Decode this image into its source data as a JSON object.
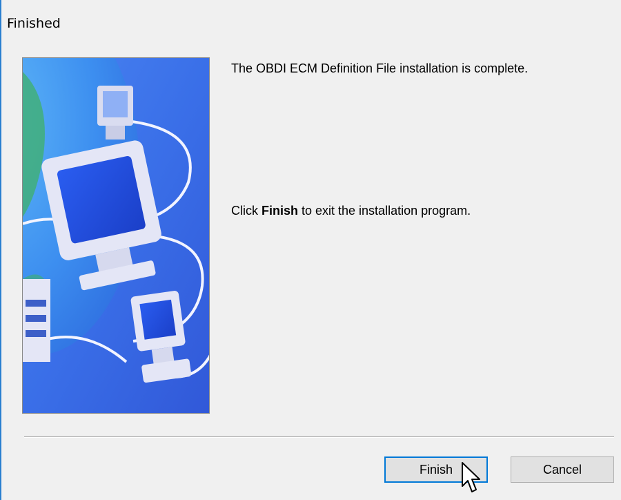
{
  "window": {
    "title": "Finished"
  },
  "content": {
    "line1": "The OBDI ECM Definition File installation is complete.",
    "line2_prefix": "Click ",
    "line2_bold": "Finish",
    "line2_suffix": " to exit the installation program."
  },
  "buttons": {
    "finish_label": "Finish",
    "cancel_label": "Cancel"
  },
  "colors": {
    "background": "#f0f0f0",
    "focus_border": "#0078d7",
    "illustration_blue": "#3b7bf0"
  },
  "icons": {
    "illustration": "networked-computers-illustration",
    "cursor": "mouse-pointer-icon"
  }
}
